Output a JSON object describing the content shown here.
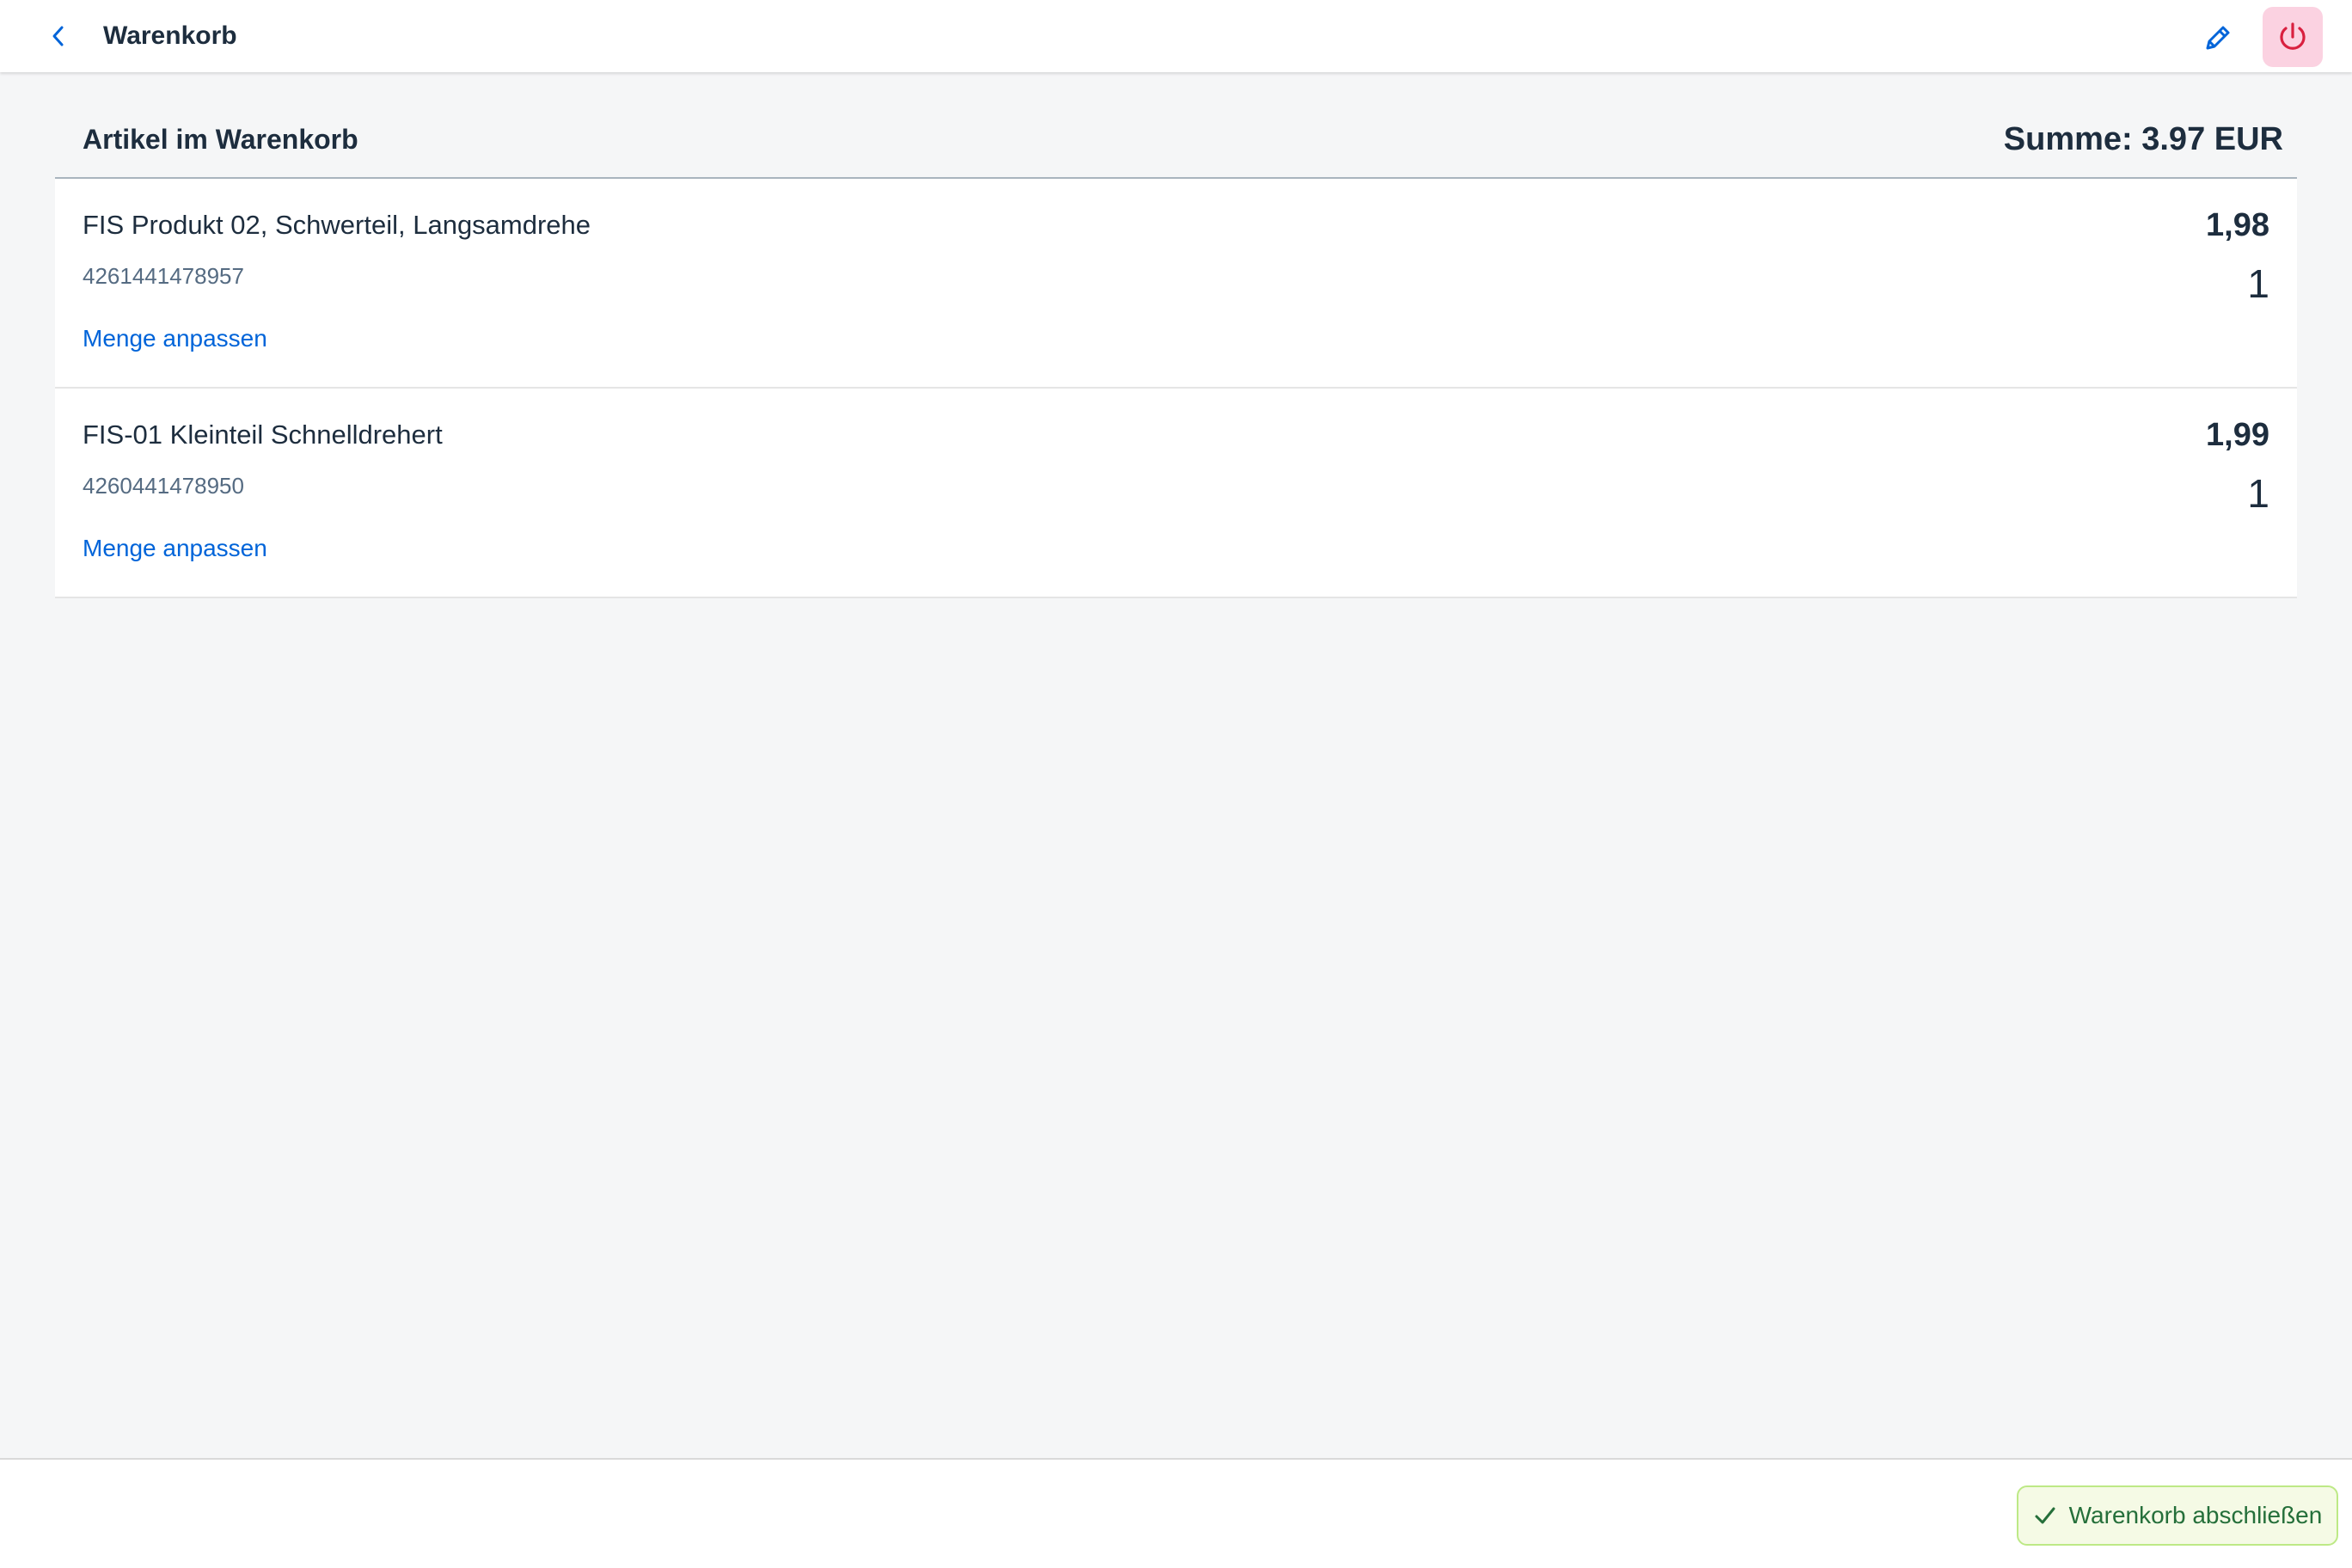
{
  "header": {
    "title": "Warenkorb",
    "back_icon": "chevron-left-icon",
    "edit_icon": "pencil-icon",
    "power_icon": "power-icon"
  },
  "list_header": {
    "title": "Artikel im Warenkorb",
    "sum": "Summe: 3.97 EUR"
  },
  "items": [
    {
      "name": "FIS Produkt 02, Schwerteil, Langsamdrehe",
      "ean": "4261441478957",
      "link": "Menge anpassen",
      "price": "1,98",
      "qty": "1"
    },
    {
      "name": "FIS-01 Kleinteil Schnelldrehert",
      "ean": "4260441478950",
      "link": "Menge anpassen",
      "price": "1,99",
      "qty": "1"
    }
  ],
  "footer": {
    "complete_label": "Warenkorb abschließen",
    "complete_icon": "checkmark-icon"
  },
  "colors": {
    "accent": "#0064d9",
    "power_bg": "#fbd2e1",
    "power_icon": "#d9203f",
    "success_bg": "#f5fae5",
    "success_text": "#256f3a"
  }
}
